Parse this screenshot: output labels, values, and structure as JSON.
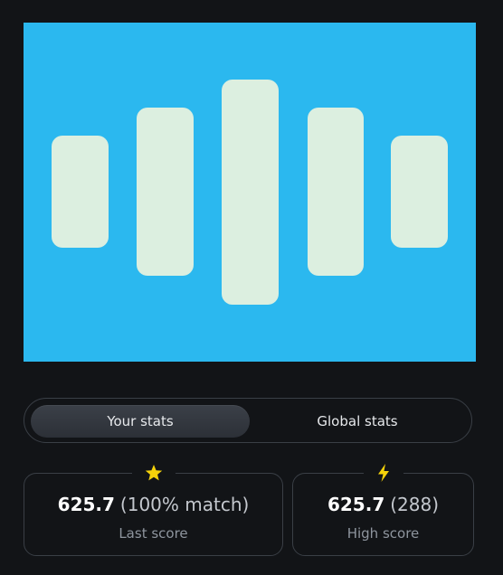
{
  "game": {
    "background_color": "#2bb8ef",
    "bar_color": "#dcefe0",
    "bar_count": 5
  },
  "tabs": {
    "your_stats_label": "Your stats",
    "global_stats_label": "Global stats",
    "active": "your_stats"
  },
  "stats": {
    "last": {
      "icon": "star-icon",
      "icon_color": "#f5d20a",
      "value": "625.7",
      "extra": "(100% match)",
      "caption": "Last score"
    },
    "high": {
      "icon": "lightning-icon",
      "icon_color": "#f5d20a",
      "value": "625.7",
      "extra": "(288)",
      "caption": "High score"
    }
  }
}
